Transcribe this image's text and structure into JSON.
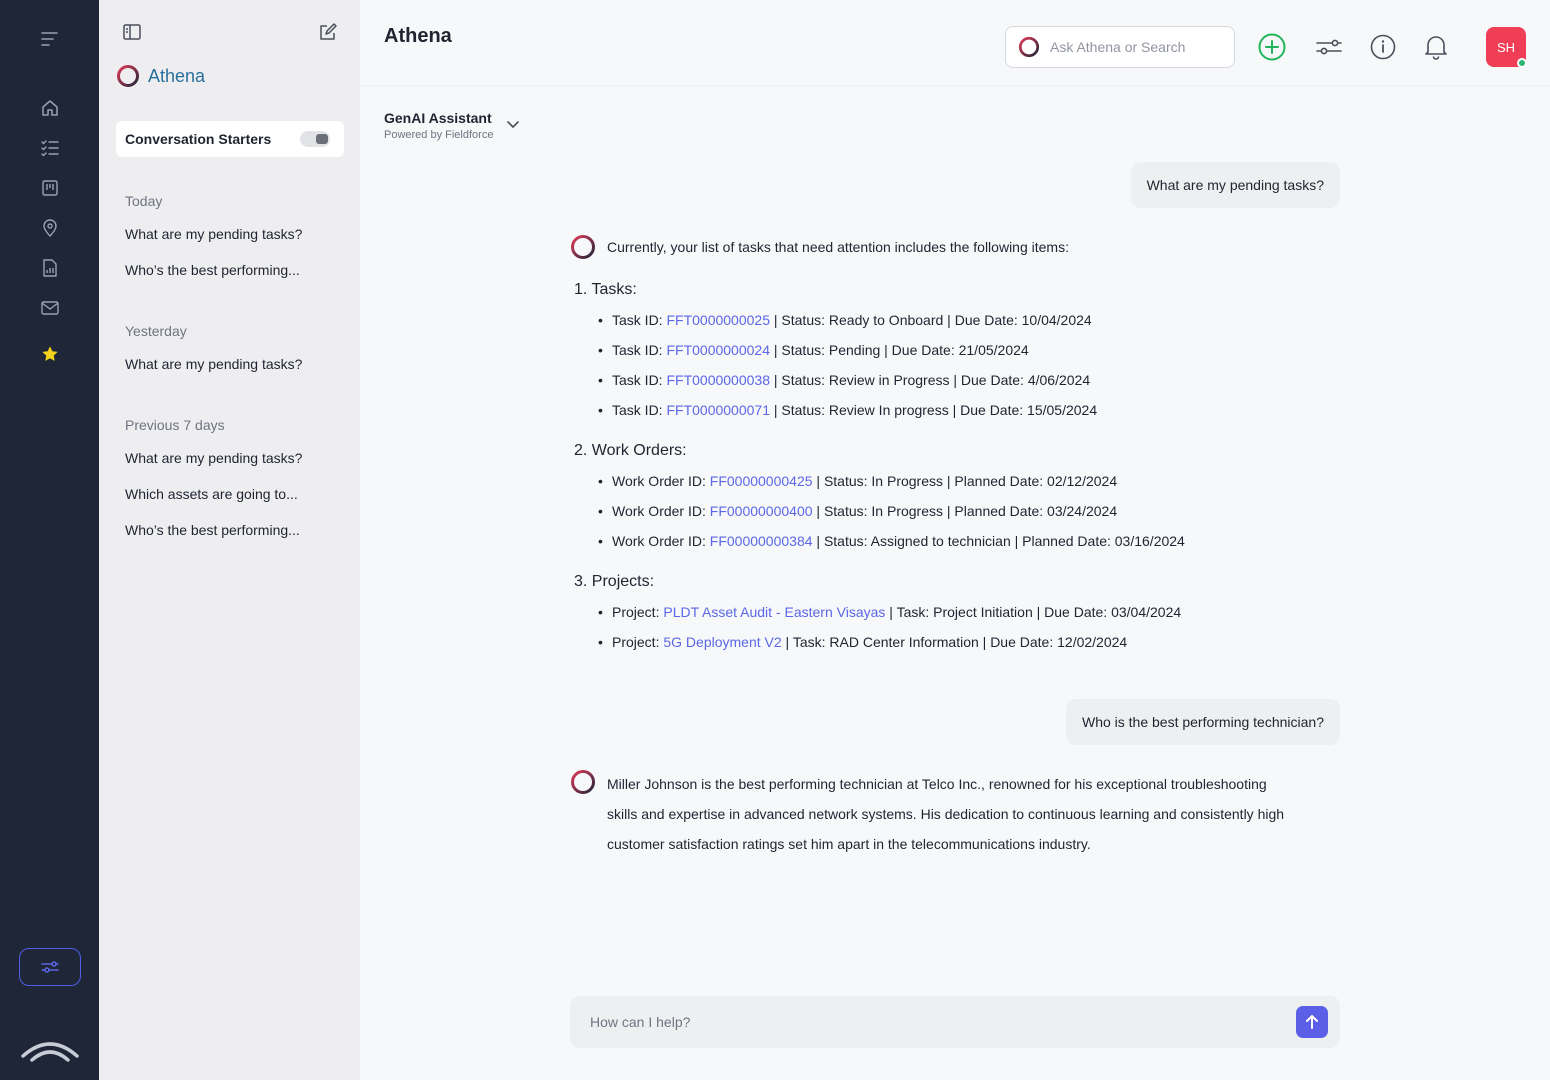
{
  "app": {
    "title": "Athena",
    "brand_name": "Athena"
  },
  "rail": {
    "items": [
      {
        "icon": "menu-icon"
      },
      {
        "icon": "home-icon"
      },
      {
        "icon": "checklist-icon"
      },
      {
        "icon": "board-icon"
      },
      {
        "icon": "location-pin-icon"
      },
      {
        "icon": "report-icon"
      },
      {
        "icon": "mail-icon"
      },
      {
        "icon": "star-icon",
        "active": true
      }
    ],
    "accent_color": "#4f5ee8",
    "star_color": "#f2d21c"
  },
  "sidebar": {
    "starters_label": "Conversation Starters",
    "starters_enabled": false,
    "sections": [
      {
        "label": "Today",
        "items": [
          "What are my pending tasks?",
          "Who’s the best performing..."
        ]
      },
      {
        "label": "Yesterday",
        "items": [
          "What are my pending tasks?"
        ]
      },
      {
        "label": "Previous 7 days",
        "items": [
          "What are my pending tasks?",
          "Which assets are going to...",
          "Who’s the best performing..."
        ]
      }
    ]
  },
  "header": {
    "search_placeholder": "Ask Athena or Search",
    "avatar_initials": "SH",
    "avatar_color": "#ef3e55"
  },
  "assistant": {
    "name": "GenAI Assistant",
    "powered_by": "Powered by Fieldforce"
  },
  "chat": {
    "q1": "What are my pending tasks?",
    "a1_intro": "Currently, your list of tasks that need attention includes the following items:",
    "tasks_heading": "1. Tasks:",
    "tasks": [
      {
        "prefix": "Task ID: ",
        "id": "FFT0000000025",
        "rest": " | Status: Ready to Onboard | Due Date: 10/04/2024"
      },
      {
        "prefix": "Task ID: ",
        "id": "FFT0000000024",
        "rest": " | Status: Pending | Due Date: 21/05/2024"
      },
      {
        "prefix": "Task ID: ",
        "id": "FFT0000000038",
        "rest": " | Status: Review in Progress | Due Date: 4/06/2024"
      },
      {
        "prefix": "Task ID: ",
        "id": "FFT0000000071",
        "rest": " | Status: Review In progress | Due Date: 15/05/2024"
      }
    ],
    "workorders_heading": "2. Work Orders:",
    "workorders": [
      {
        "prefix": "Work Order ID: ",
        "id": "FF00000000425",
        "rest": " | Status: In Progress | Planned Date: 02/12/2024"
      },
      {
        "prefix": "Work Order ID: ",
        "id": "FF00000000400",
        "rest": " | Status: In Progress | Planned Date: 03/24/2024"
      },
      {
        "prefix": "Work Order ID: ",
        "id": "FF00000000384",
        "rest": " | Status: Assigned to technician | Planned Date: 03/16/2024"
      }
    ],
    "projects_heading": "3. Projects:",
    "projects": [
      {
        "prefix": "Project: ",
        "id": "PLDT Asset Audit - Eastern Visayas",
        "rest": " | Task: Project Initiation | Due Date: 03/04/2024"
      },
      {
        "prefix": "Project: ",
        "id": "5G Deployment V2",
        "rest": " | Task: RAD Center Information | Due Date: 12/02/2024"
      }
    ],
    "q2": "Who is the best performing technician?",
    "a2_lines": [
      "Miller Johnson is the best performing technician at Telco Inc., renowned for his exceptional troubleshooting",
      "skills and expertise in advanced network systems. His dedication to continuous learning and consistently high",
      "customer satisfaction ratings set him apart in the telecommunications industry."
    ]
  },
  "composer": {
    "placeholder": "How can I help?",
    "send_color": "#5b5fe8"
  }
}
